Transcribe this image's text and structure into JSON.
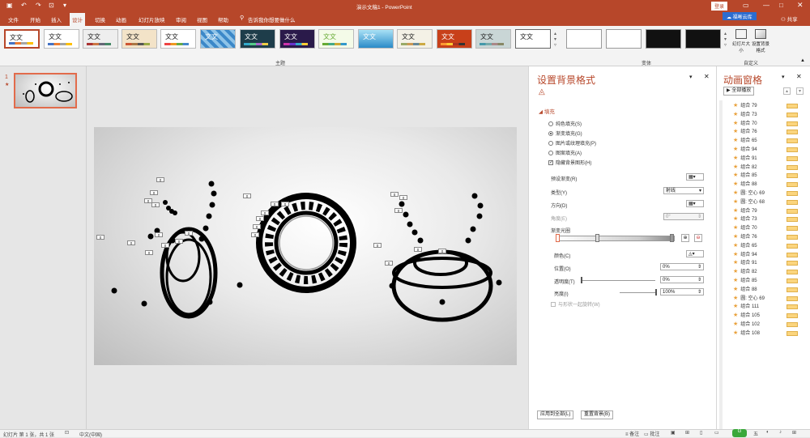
{
  "window": {
    "title": "演示文稿1 - PowerPoint",
    "login": "登录",
    "share": "共享",
    "cloud": "福晰云库"
  },
  "tabs": [
    {
      "label": "文件"
    },
    {
      "label": "开始"
    },
    {
      "label": "插入"
    },
    {
      "label": "设计"
    },
    {
      "label": "切换"
    },
    {
      "label": "动画"
    },
    {
      "label": "幻灯片放映"
    },
    {
      "label": "审阅"
    },
    {
      "label": "视图"
    },
    {
      "label": "帮助"
    }
  ],
  "tell_me": "告诉我你想要做什么",
  "ribbon": {
    "themes_label": "主题",
    "variants_label": "变体",
    "customize_label": "自定义",
    "theme_text": "文文",
    "slide_size": "幻灯片大小",
    "format_bg": "设置背景格式"
  },
  "thumb": {
    "number": "1",
    "star": "★"
  },
  "format_pane": {
    "title": "设置背景格式",
    "section": "填充",
    "options": [
      {
        "label": "纯色填充(S)"
      },
      {
        "label": "渐变填充(G)"
      },
      {
        "label": "图片或纹理填充(P)"
      },
      {
        "label": "图案填充(A)"
      }
    ],
    "hide_bg": "隐藏背景图形(H)",
    "preset_label": "预设渐变(R)",
    "type_label": "类型(Y)",
    "type_value": "射线",
    "direction_label": "方向(D)",
    "angle_label": "角度(E)",
    "angle_value": "0°",
    "stops_label": "渐变光圈",
    "color_label": "颜色(C)",
    "position_label": "位置(O)",
    "position_value": "0%",
    "transparency_label": "透明度(T)",
    "transparency_value": "0%",
    "brightness_label": "亮度(I)",
    "brightness_value": "100%",
    "rotate_label": "与形状一起旋转(W)",
    "apply_all": "应用到全部(L)",
    "reset": "重置背景(B)"
  },
  "anim_pane": {
    "title": "动画窗格",
    "play_all": "全部播放",
    "items": [
      "组合 79",
      "组合 73",
      "组合 70",
      "组合 76",
      "组合 65",
      "组合 94",
      "组合 91",
      "组合 82",
      "组合 85",
      "组合 88",
      "圆: 空心 69",
      "圆: 空心 68",
      "组合 79",
      "组合 73",
      "组合 70",
      "组合 76",
      "组合 65",
      "组合 94",
      "组合 91",
      "组合 82",
      "组合 85",
      "组合 88",
      "圆: 空心 69",
      "组合 111",
      "组合 105",
      "组合 102",
      "组合 108"
    ]
  },
  "slide_tag": "0",
  "status": {
    "slide": "幻灯片 第 1 张，共 1 张",
    "lang": "中文(中国)",
    "notes": "备注",
    "comments": "批注"
  }
}
